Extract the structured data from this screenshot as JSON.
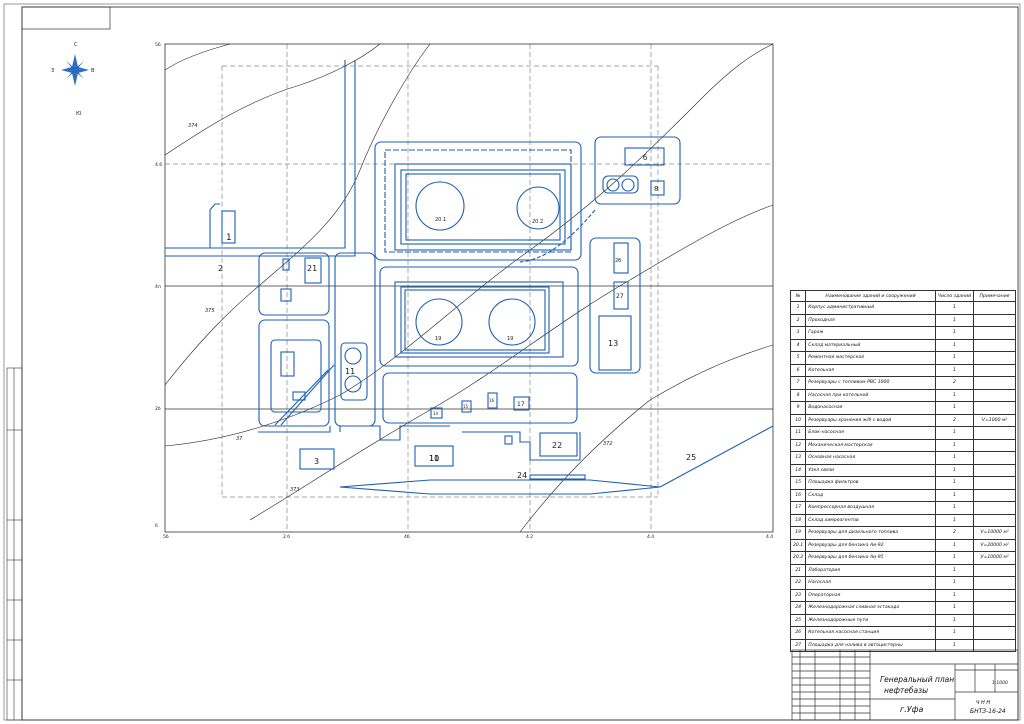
{
  "compass": {
    "north": "С",
    "west": "З",
    "east": "В",
    "south": "Ю"
  },
  "grid_labels": {
    "left": [
      "56",
      "4.6",
      "4п",
      "2б",
      "б"
    ],
    "bottom": [
      "5б",
      "2.б",
      "4б",
      "4.2",
      "4.4",
      "4.4"
    ]
  },
  "contours": [
    "374",
    "375",
    "37",
    "373",
    "372"
  ],
  "building_numbers": [
    "1",
    "2",
    "21",
    "11",
    "б",
    "8",
    "20.1",
    "20.2",
    "2б",
    "27",
    "19",
    "19",
    "13",
    "10",
    "3",
    "11",
    "22",
    "24",
    "25",
    "14",
    "15",
    "16",
    "17"
  ],
  "schedule": {
    "headers": [
      "№",
      "Наименование зданий и сооружений",
      "Число зданий",
      "Примечание"
    ],
    "rows": [
      {
        "no": "1",
        "name": "Корпус административный",
        "count": "1",
        "note": ""
      },
      {
        "no": "2",
        "name": "Проходная",
        "count": "1",
        "note": ""
      },
      {
        "no": "3",
        "name": "Гараж",
        "count": "1",
        "note": ""
      },
      {
        "no": "4",
        "name": "Склад материальный",
        "count": "1",
        "note": ""
      },
      {
        "no": "5",
        "name": "Ремонтная мастерская",
        "count": "1",
        "note": ""
      },
      {
        "no": "6",
        "name": "Котельная",
        "count": "1",
        "note": ""
      },
      {
        "no": "7",
        "name": "Резервуары с топливом РВС 1000",
        "count": "2",
        "note": ""
      },
      {
        "no": "8",
        "name": "Насосная при котельной",
        "count": "1",
        "note": ""
      },
      {
        "no": "9",
        "name": "Водонасосная",
        "count": "1",
        "note": ""
      },
      {
        "no": "10",
        "name": "Резервуары хранения ж/б с водой",
        "count": "2",
        "note": "V=1000 м²"
      },
      {
        "no": "11",
        "name": "Блок-насосная",
        "count": "1",
        "note": ""
      },
      {
        "no": "12",
        "name": "Механическая мастерская",
        "count": "1",
        "note": ""
      },
      {
        "no": "13",
        "name": "Основная насосная",
        "count": "1",
        "note": ""
      },
      {
        "no": "14",
        "name": "Узел связи",
        "count": "1",
        "note": ""
      },
      {
        "no": "15",
        "name": "Площадка фильтров",
        "count": "1",
        "note": ""
      },
      {
        "no": "16",
        "name": "Склад",
        "count": "1",
        "note": ""
      },
      {
        "no": "17",
        "name": "Компрессорная воздушная",
        "count": "1",
        "note": ""
      },
      {
        "no": "18",
        "name": "Склад химреагентов",
        "count": "1",
        "note": ""
      },
      {
        "no": "19",
        "name": "Резервуары для дизельного топлива",
        "count": "2",
        "note": "V=10000 м²"
      },
      {
        "no": "20.1",
        "name": "Резервуары для бензина Аи-92",
        "count": "1",
        "note": "V=20000 м²"
      },
      {
        "no": "20.2",
        "name": "Резервуары для бензина Аи-95",
        "count": "1",
        "note": "V=10000 м²"
      },
      {
        "no": "21",
        "name": "Лаборатория",
        "count": "1",
        "note": ""
      },
      {
        "no": "22",
        "name": "Насосная",
        "count": "1",
        "note": ""
      },
      {
        "no": "23",
        "name": "Операторная",
        "count": "1",
        "note": ""
      },
      {
        "no": "24",
        "name": "Железнодорожная сливная эстакада",
        "count": "1",
        "note": ""
      },
      {
        "no": "25",
        "name": "Железнодорожные пути",
        "count": "1",
        "note": ""
      },
      {
        "no": "26",
        "name": "Котельная насосная станция",
        "count": "1",
        "note": ""
      },
      {
        "no": "27",
        "name": "Площадка для налива в автоцистерны",
        "count": "1",
        "note": ""
      }
    ]
  },
  "title_block": {
    "title_line1": "Генеральный план",
    "title_line2": "нефтебазы",
    "city": "г.Уфа",
    "scale": "1:1000",
    "sheet": "Ч Н Н",
    "code": "БНТЗ-16-24"
  },
  "colors": {
    "plan_blue": "#1d5fb4",
    "line_dark": "#222222"
  }
}
